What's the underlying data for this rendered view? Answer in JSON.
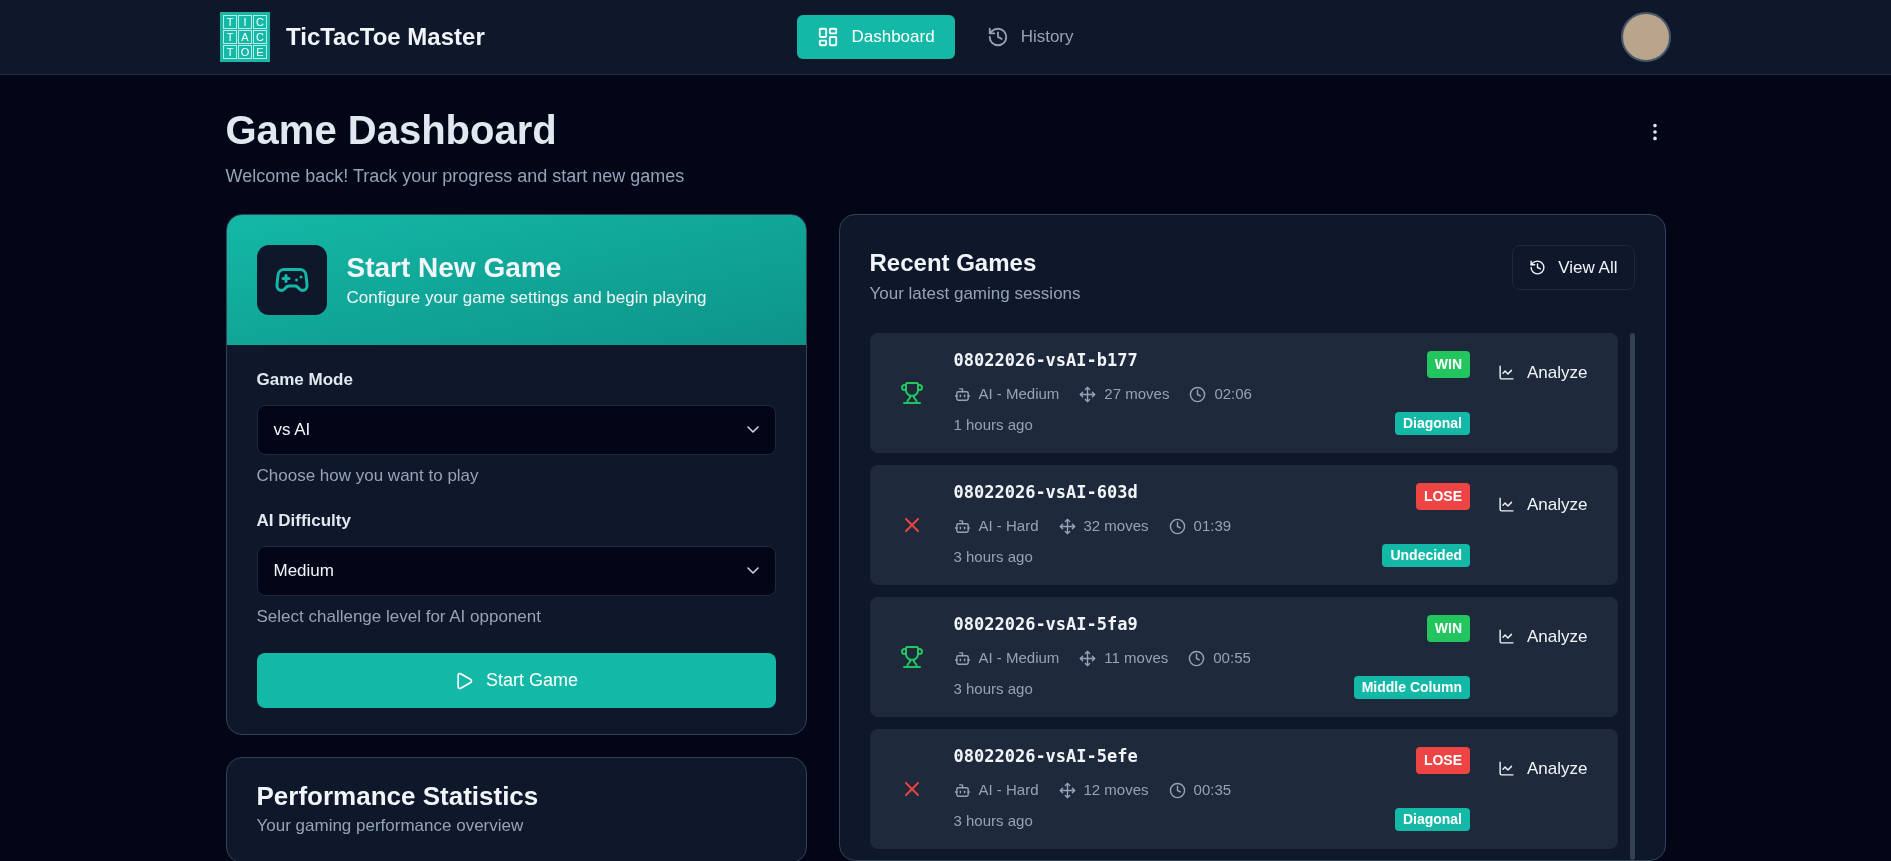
{
  "header": {
    "logo_cells": [
      "T",
      "I",
      "C",
      "T",
      "A",
      "C",
      "T",
      "O",
      "E"
    ],
    "app_name": "TicTacToe Master",
    "nav": [
      {
        "label": "Dashboard",
        "selected": true
      },
      {
        "label": "History",
        "selected": false
      }
    ]
  },
  "page": {
    "title": "Game Dashboard",
    "subtitle": "Welcome back! Track your progress and start new games"
  },
  "new_game": {
    "title": "Start New Game",
    "subtitle": "Configure your game settings and begin playing",
    "fields": [
      {
        "label": "Game Mode",
        "value": "vs AI",
        "help": "Choose how you want to play"
      },
      {
        "label": "AI Difficulty",
        "value": "Medium",
        "help": "Select challenge level for AI opponent"
      }
    ],
    "button": "Start Game"
  },
  "stats": {
    "title": "Performance Statistics",
    "subtitle": "Your gaming performance overview"
  },
  "recent": {
    "title": "Recent Games",
    "subtitle": "Your latest gaming sessions",
    "view_all": "View All",
    "games": [
      {
        "id": "08022026-vsAI-b177",
        "kind": "win",
        "badge": "WIN",
        "opponent": "AI - Medium",
        "moves": "27 moves",
        "duration": "02:06",
        "time": "1 hours ago",
        "tag": "Diagonal",
        "action": "Analyze"
      },
      {
        "id": "08022026-vsAI-603d",
        "kind": "lose",
        "badge": "LOSE",
        "opponent": "AI - Hard",
        "moves": "32 moves",
        "duration": "01:39",
        "time": "3 hours ago",
        "tag": "Undecided",
        "action": "Analyze"
      },
      {
        "id": "08022026-vsAI-5fa9",
        "kind": "win",
        "badge": "WIN",
        "opponent": "AI - Medium",
        "moves": "11 moves",
        "duration": "00:55",
        "time": "3 hours ago",
        "tag": "Middle Column",
        "action": "Analyze"
      },
      {
        "id": "08022026-vsAI-5efe",
        "kind": "lose",
        "badge": "LOSE",
        "opponent": "AI - Hard",
        "moves": "12 moves",
        "duration": "00:35",
        "time": "3 hours ago",
        "tag": "Diagonal",
        "action": "Analyze"
      }
    ]
  }
}
